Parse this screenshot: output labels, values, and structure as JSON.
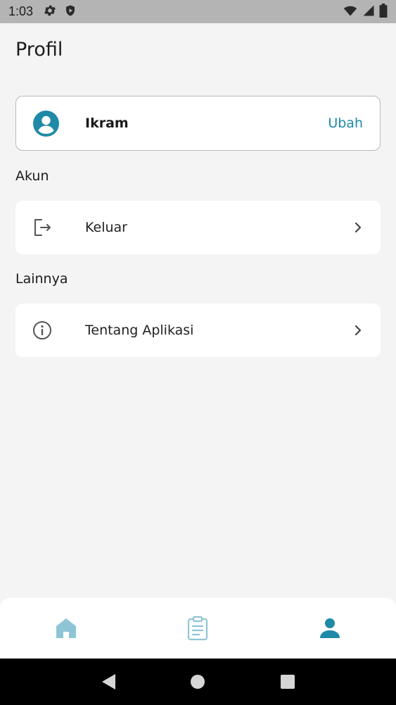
{
  "status_bar": {
    "time": "1:03",
    "icons": [
      "gear-icon",
      "shield-icon",
      "wifi-icon",
      "signal-icon",
      "battery-icon"
    ]
  },
  "page": {
    "title": "Profil"
  },
  "profile": {
    "name": "Ikram",
    "edit_label": "Ubah"
  },
  "sections": {
    "account": {
      "label": "Akun",
      "items": [
        {
          "label": "Keluar",
          "icon": "logout-icon"
        }
      ]
    },
    "others": {
      "label": "Lainnya",
      "items": [
        {
          "label": "Tentang Aplikasi",
          "icon": "info-icon"
        }
      ]
    }
  },
  "bottom_nav": {
    "items": [
      {
        "icon": "home-icon",
        "active": false
      },
      {
        "icon": "clipboard-icon",
        "active": false
      },
      {
        "icon": "person-icon",
        "active": true
      }
    ]
  },
  "colors": {
    "accent": "#1f8aa8",
    "nav_inactive": "#8ec5d6",
    "background": "#f4f4f4",
    "card": "#ffffff"
  }
}
